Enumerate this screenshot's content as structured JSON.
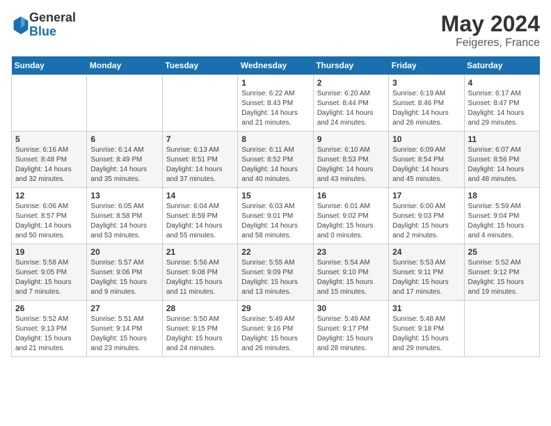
{
  "header": {
    "logo_general": "General",
    "logo_blue": "Blue",
    "title": "May 2024",
    "location": "Feigeres, France"
  },
  "days_of_week": [
    "Sunday",
    "Monday",
    "Tuesday",
    "Wednesday",
    "Thursday",
    "Friday",
    "Saturday"
  ],
  "weeks": [
    [
      {
        "day": "",
        "info": ""
      },
      {
        "day": "",
        "info": ""
      },
      {
        "day": "",
        "info": ""
      },
      {
        "day": "1",
        "info": "Sunrise: 6:22 AM\nSunset: 8:43 PM\nDaylight: 14 hours\nand 21 minutes."
      },
      {
        "day": "2",
        "info": "Sunrise: 6:20 AM\nSunset: 8:44 PM\nDaylight: 14 hours\nand 24 minutes."
      },
      {
        "day": "3",
        "info": "Sunrise: 6:19 AM\nSunset: 8:46 PM\nDaylight: 14 hours\nand 26 minutes."
      },
      {
        "day": "4",
        "info": "Sunrise: 6:17 AM\nSunset: 8:47 PM\nDaylight: 14 hours\nand 29 minutes."
      }
    ],
    [
      {
        "day": "5",
        "info": "Sunrise: 6:16 AM\nSunset: 8:48 PM\nDaylight: 14 hours\nand 32 minutes."
      },
      {
        "day": "6",
        "info": "Sunrise: 6:14 AM\nSunset: 8:49 PM\nDaylight: 14 hours\nand 35 minutes."
      },
      {
        "day": "7",
        "info": "Sunrise: 6:13 AM\nSunset: 8:51 PM\nDaylight: 14 hours\nand 37 minutes."
      },
      {
        "day": "8",
        "info": "Sunrise: 6:11 AM\nSunset: 8:52 PM\nDaylight: 14 hours\nand 40 minutes."
      },
      {
        "day": "9",
        "info": "Sunrise: 6:10 AM\nSunset: 8:53 PM\nDaylight: 14 hours\nand 43 minutes."
      },
      {
        "day": "10",
        "info": "Sunrise: 6:09 AM\nSunset: 8:54 PM\nDaylight: 14 hours\nand 45 minutes."
      },
      {
        "day": "11",
        "info": "Sunrise: 6:07 AM\nSunset: 8:56 PM\nDaylight: 14 hours\nand 48 minutes."
      }
    ],
    [
      {
        "day": "12",
        "info": "Sunrise: 6:06 AM\nSunset: 8:57 PM\nDaylight: 14 hours\nand 50 minutes."
      },
      {
        "day": "13",
        "info": "Sunrise: 6:05 AM\nSunset: 8:58 PM\nDaylight: 14 hours\nand 53 minutes."
      },
      {
        "day": "14",
        "info": "Sunrise: 6:04 AM\nSunset: 8:59 PM\nDaylight: 14 hours\nand 55 minutes."
      },
      {
        "day": "15",
        "info": "Sunrise: 6:03 AM\nSunset: 9:01 PM\nDaylight: 14 hours\nand 58 minutes."
      },
      {
        "day": "16",
        "info": "Sunrise: 6:01 AM\nSunset: 9:02 PM\nDaylight: 15 hours\nand 0 minutes."
      },
      {
        "day": "17",
        "info": "Sunrise: 6:00 AM\nSunset: 9:03 PM\nDaylight: 15 hours\nand 2 minutes."
      },
      {
        "day": "18",
        "info": "Sunrise: 5:59 AM\nSunset: 9:04 PM\nDaylight: 15 hours\nand 4 minutes."
      }
    ],
    [
      {
        "day": "19",
        "info": "Sunrise: 5:58 AM\nSunset: 9:05 PM\nDaylight: 15 hours\nand 7 minutes."
      },
      {
        "day": "20",
        "info": "Sunrise: 5:57 AM\nSunset: 9:06 PM\nDaylight: 15 hours\nand 9 minutes."
      },
      {
        "day": "21",
        "info": "Sunrise: 5:56 AM\nSunset: 9:08 PM\nDaylight: 15 hours\nand 11 minutes."
      },
      {
        "day": "22",
        "info": "Sunrise: 5:55 AM\nSunset: 9:09 PM\nDaylight: 15 hours\nand 13 minutes."
      },
      {
        "day": "23",
        "info": "Sunrise: 5:54 AM\nSunset: 9:10 PM\nDaylight: 15 hours\nand 15 minutes."
      },
      {
        "day": "24",
        "info": "Sunrise: 5:53 AM\nSunset: 9:11 PM\nDaylight: 15 hours\nand 17 minutes."
      },
      {
        "day": "25",
        "info": "Sunrise: 5:52 AM\nSunset: 9:12 PM\nDaylight: 15 hours\nand 19 minutes."
      }
    ],
    [
      {
        "day": "26",
        "info": "Sunrise: 5:52 AM\nSunset: 9:13 PM\nDaylight: 15 hours\nand 21 minutes."
      },
      {
        "day": "27",
        "info": "Sunrise: 5:51 AM\nSunset: 9:14 PM\nDaylight: 15 hours\nand 23 minutes."
      },
      {
        "day": "28",
        "info": "Sunrise: 5:50 AM\nSunset: 9:15 PM\nDaylight: 15 hours\nand 24 minutes."
      },
      {
        "day": "29",
        "info": "Sunrise: 5:49 AM\nSunset: 9:16 PM\nDaylight: 15 hours\nand 26 minutes."
      },
      {
        "day": "30",
        "info": "Sunrise: 5:49 AM\nSunset: 9:17 PM\nDaylight: 15 hours\nand 28 minutes."
      },
      {
        "day": "31",
        "info": "Sunrise: 5:48 AM\nSunset: 9:18 PM\nDaylight: 15 hours\nand 29 minutes."
      },
      {
        "day": "",
        "info": ""
      }
    ]
  ]
}
